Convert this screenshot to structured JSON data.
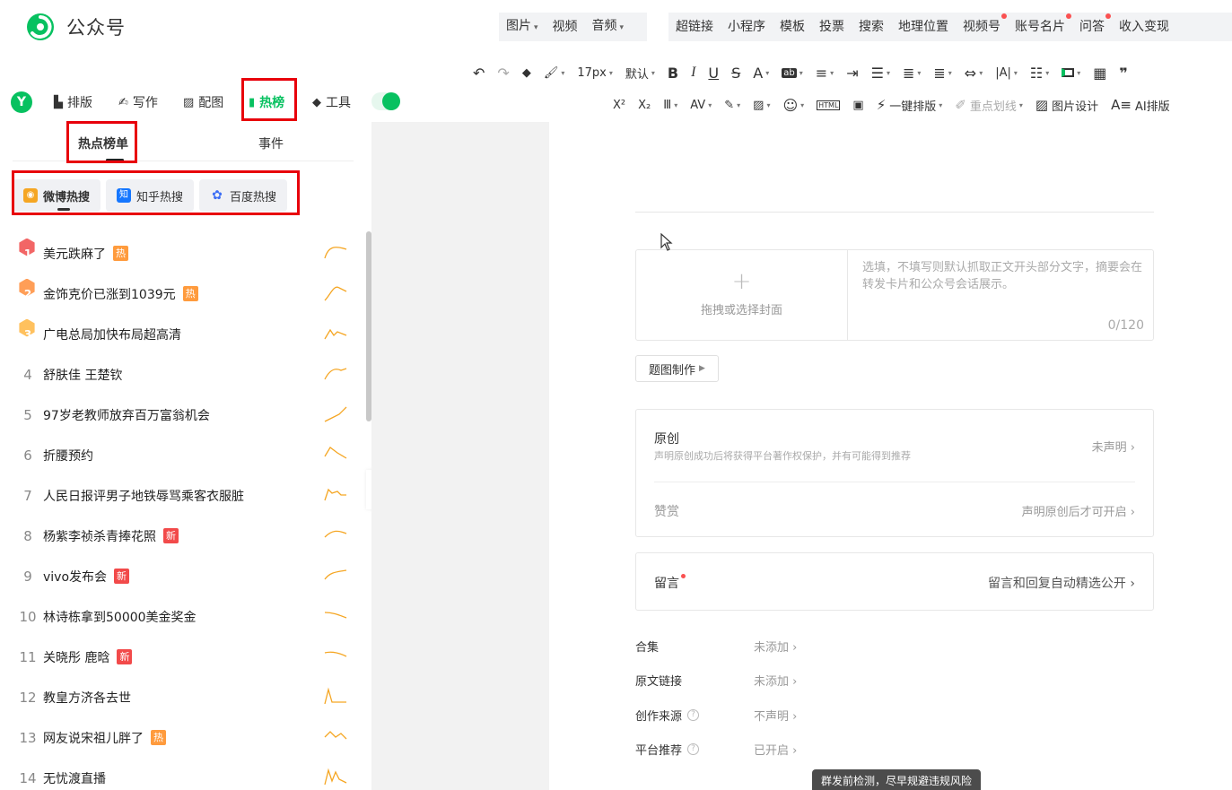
{
  "header": {
    "brand": "公众号",
    "nav_group1": [
      {
        "label": "图片",
        "caret": true
      },
      {
        "label": "视频",
        "caret": false
      },
      {
        "label": "音频",
        "caret": true
      }
    ],
    "nav_group2": [
      {
        "label": "超链接",
        "dot": false
      },
      {
        "label": "小程序",
        "dot": false
      },
      {
        "label": "模板",
        "dot": false
      },
      {
        "label": "投票",
        "dot": false
      },
      {
        "label": "搜索",
        "dot": false
      },
      {
        "label": "地理位置",
        "dot": false
      },
      {
        "label": "视频号",
        "dot": true
      },
      {
        "label": "账号名片",
        "dot": true
      },
      {
        "label": "问答",
        "dot": true
      },
      {
        "label": "收入变现",
        "dot": false
      }
    ]
  },
  "toolbar": {
    "font_size": "17px",
    "font_default": "默认",
    "one_click_layout": "一键排版",
    "highlight": "重点划线",
    "image_design": "图片设计",
    "ai_layout": "AI排版"
  },
  "plugin": {
    "logo_letter": "Y",
    "items": [
      {
        "label": "排版",
        "icon": "layout-icon"
      },
      {
        "label": "写作",
        "icon": "write-icon"
      },
      {
        "label": "配图",
        "icon": "image-icon"
      },
      {
        "label": "热榜",
        "icon": "bookmark-icon"
      },
      {
        "label": "工具",
        "icon": "cube-icon"
      }
    ]
  },
  "hot_panel": {
    "tabs": [
      "热点榜单",
      "事件"
    ],
    "sources": [
      {
        "label": "微博热搜",
        "color": "#f5a623"
      },
      {
        "label": "知乎热搜",
        "color": "#1677ff"
      },
      {
        "label": "百度热搜",
        "color": "#3b6df5"
      }
    ],
    "items": [
      {
        "rank": "1",
        "title": "美元跌麻了",
        "badge": "热",
        "badge_type": "hot"
      },
      {
        "rank": "2",
        "title": "金饰克价已涨到1039元",
        "badge": "热",
        "badge_type": "hot"
      },
      {
        "rank": "3",
        "title": "广电总局加快布局超高清",
        "badge": "",
        "badge_type": ""
      },
      {
        "rank": "4",
        "title": "舒肤佳 王楚钦",
        "badge": "",
        "badge_type": ""
      },
      {
        "rank": "5",
        "title": "97岁老教师放弃百万富翁机会",
        "badge": "",
        "badge_type": ""
      },
      {
        "rank": "6",
        "title": "折腰预约",
        "badge": "",
        "badge_type": ""
      },
      {
        "rank": "7",
        "title": "人民日报评男子地铁辱骂乘客衣服脏",
        "badge": "",
        "badge_type": ""
      },
      {
        "rank": "8",
        "title": "杨紫李祯杀青捧花照",
        "badge": "新",
        "badge_type": "new"
      },
      {
        "rank": "9",
        "title": "vivo发布会",
        "badge": "新",
        "badge_type": "new"
      },
      {
        "rank": "10",
        "title": "林诗栋拿到50000美金奖金",
        "badge": "",
        "badge_type": ""
      },
      {
        "rank": "11",
        "title": "关晓彤 鹿晗",
        "badge": "新",
        "badge_type": "new"
      },
      {
        "rank": "12",
        "title": "教皇方济各去世",
        "badge": "",
        "badge_type": ""
      },
      {
        "rank": "13",
        "title": "网友说宋祖儿胖了",
        "badge": "热",
        "badge_type": "hot"
      },
      {
        "rank": "14",
        "title": "无忧渡直播",
        "badge": "",
        "badge_type": ""
      }
    ]
  },
  "editor": {
    "cover_label": "拖拽或选择封面",
    "summary_placeholder": "选填，不填写则默认抓取正文开头部分文字，摘要会在转发卡片和公众号会话展示。",
    "summary_counter": "0/120",
    "cover_make_button": "题图制作",
    "original_title": "原创",
    "original_desc": "声明原创成功后将获得平台著作权保护，并有可能得到推荐",
    "original_status": "未声明",
    "reward_title": "赞赏",
    "reward_status": "声明原创后才可开启",
    "comment_title": "留言",
    "comment_status": "留言和回复自动精选公开",
    "meta": [
      {
        "label": "合集",
        "value": "未添加",
        "help": false
      },
      {
        "label": "原文链接",
        "value": "未添加",
        "help": false
      },
      {
        "label": "创作来源",
        "value": "不声明",
        "help": true
      },
      {
        "label": "平台推荐",
        "value": "已开启",
        "help": true
      }
    ],
    "tooltip": "群发前检测，尽早规避违规风险"
  },
  "colors": {
    "brand_green": "#07c160",
    "highlight_red": "#e8000b",
    "trend_orange": "#f5a623"
  }
}
